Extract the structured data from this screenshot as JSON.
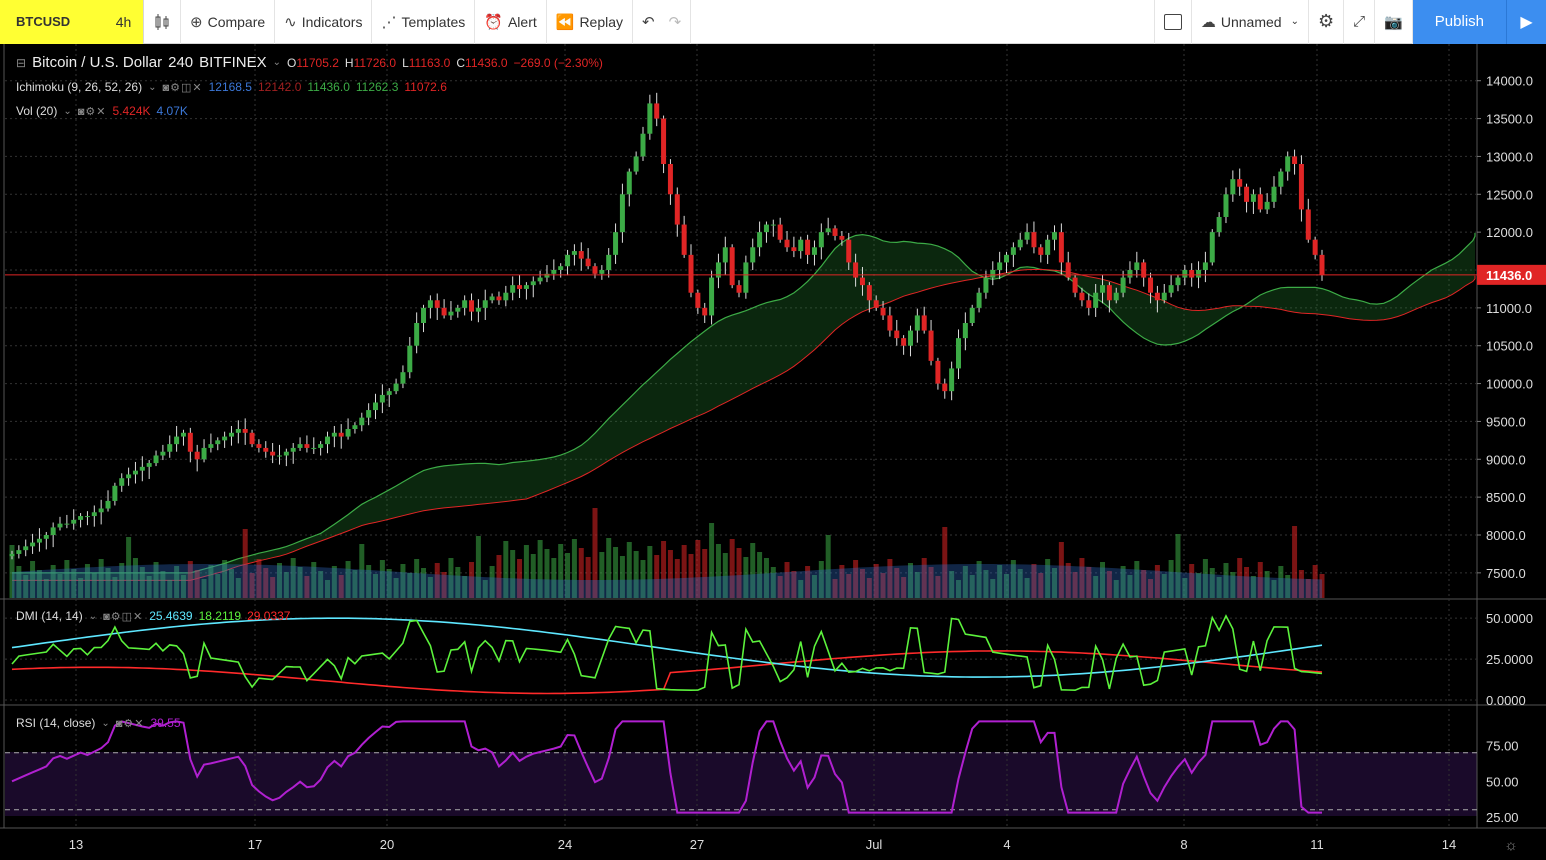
{
  "toolbar": {
    "symbol": "BTCUSD",
    "interval": "4h",
    "compare": "Compare",
    "indicators": "Indicators",
    "templates": "Templates",
    "alert": "Alert",
    "replay": "Replay",
    "layout_name": "Unnamed",
    "publish": "Publish"
  },
  "main_legend": {
    "title": "Bitcoin / U.S. Dollar",
    "interval": "240",
    "exchange": "BITFINEX",
    "o_label": "O",
    "o": "11705.2",
    "h_label": "H",
    "h": "11726.0",
    "l_label": "L",
    "l": "11163.0",
    "c_label": "C",
    "c": "11436.0",
    "change": "−269.0 (−2.30%)"
  },
  "ichimoku_legend": {
    "name": "Ichimoku (9, 26, 52, 26)",
    "v1": "12168.5",
    "v2": "12142.0",
    "v3": "11436.0",
    "v4": "11262.3",
    "v5": "11072.6"
  },
  "vol_legend": {
    "name": "Vol (20)",
    "v1": "5.424K",
    "v2": "4.07K"
  },
  "dmi_legend": {
    "name": "DMI (14, 14)",
    "v1": "25.4639",
    "v2": "18.2119",
    "v3": "29.0337"
  },
  "rsi_legend": {
    "name": "RSI (14, close)",
    "v1": "39.55"
  },
  "price_axis": [
    "14000.0",
    "13500.0",
    "13000.0",
    "12500.0",
    "12000.0",
    "11500.0",
    "11000.0",
    "10500.0",
    "10000.0",
    "9500.0",
    "9000.0",
    "8500.0",
    "8000.0",
    "7500.0"
  ],
  "current_price": "11436.0",
  "dmi_axis": [
    "50.0000",
    "25.0000",
    "0.0000"
  ],
  "rsi_axis": [
    "75.00",
    "50.00",
    "25.00"
  ],
  "time_axis": [
    "13",
    "17",
    "20",
    "24",
    "27",
    "Jul",
    "4",
    "8",
    "11",
    "14"
  ],
  "colors": {
    "up": "#3cab46",
    "down": "#e02525",
    "cloud_up": "#1b5e20",
    "cloud_down": "#5a1010",
    "dmi_plus": "#5cf23c",
    "dmi_minus": "#ff2a2a",
    "adx": "#5ee7ff",
    "rsi": "#b020d0"
  },
  "chart_data": {
    "type": "candlestick",
    "title": "Bitcoin / U.S. Dollar 240 BITFINEX",
    "ylim": [
      7300,
      14300
    ],
    "close_series": [
      7750,
      7800,
      7850,
      7900,
      7950,
      8000,
      8100,
      8150,
      8150,
      8200,
      8250,
      8250,
      8300,
      8350,
      8450,
      8650,
      8750,
      8800,
      8850,
      8900,
      8950,
      9050,
      9100,
      9200,
      9300,
      9350,
      9100,
      9000,
      9150,
      9200,
      9250,
      9300,
      9350,
      9400,
      9350,
      9200,
      9150,
      9100,
      9050,
      9050,
      9100,
      9150,
      9200,
      9150,
      9150,
      9200,
      9300,
      9350,
      9300,
      9400,
      9450,
      9550,
      9650,
      9750,
      9850,
      9900,
      10000,
      10150,
      10500,
      10800,
      11000,
      11100,
      11000,
      10900,
      10950,
      11000,
      11100,
      10950,
      11000,
      11100,
      11150,
      11100,
      11200,
      11300,
      11250,
      11300,
      11350,
      11400,
      11450,
      11500,
      11550,
      11700,
      11750,
      11650,
      11550,
      11450,
      11500,
      11700,
      12000,
      12500,
      12800,
      13000,
      13300,
      13700,
      13500,
      12900,
      12500,
      12100,
      11700,
      11200,
      11000,
      10900,
      11400,
      11600,
      11800,
      11300,
      11200,
      11600,
      11800,
      12000,
      12100,
      12100,
      11900,
      11800,
      11750,
      11900,
      11700,
      11800,
      12000,
      12050,
      11950,
      11900,
      11600,
      11400,
      11300,
      11100,
      11000,
      10900,
      10700,
      10600,
      10500,
      10700,
      10900,
      10700,
      10300,
      10000,
      9900,
      10200,
      10600,
      10800,
      11000,
      11200,
      11400,
      11500,
      11600,
      11700,
      11800,
      11900,
      12000,
      11800,
      11700,
      11900,
      12000,
      11600,
      11400,
      11200,
      11100,
      11000,
      11200,
      11300,
      11100,
      11200,
      11400,
      11500,
      11600,
      11400,
      11200,
      11100,
      11200,
      11300,
      11400,
      11500,
      11400,
      11500,
      11600,
      12000,
      12200,
      12500,
      12700,
      12600,
      12400,
      12500,
      12300,
      12400,
      12600,
      12800,
      13000,
      12900,
      12300,
      11900,
      11700,
      11436
    ]
  }
}
